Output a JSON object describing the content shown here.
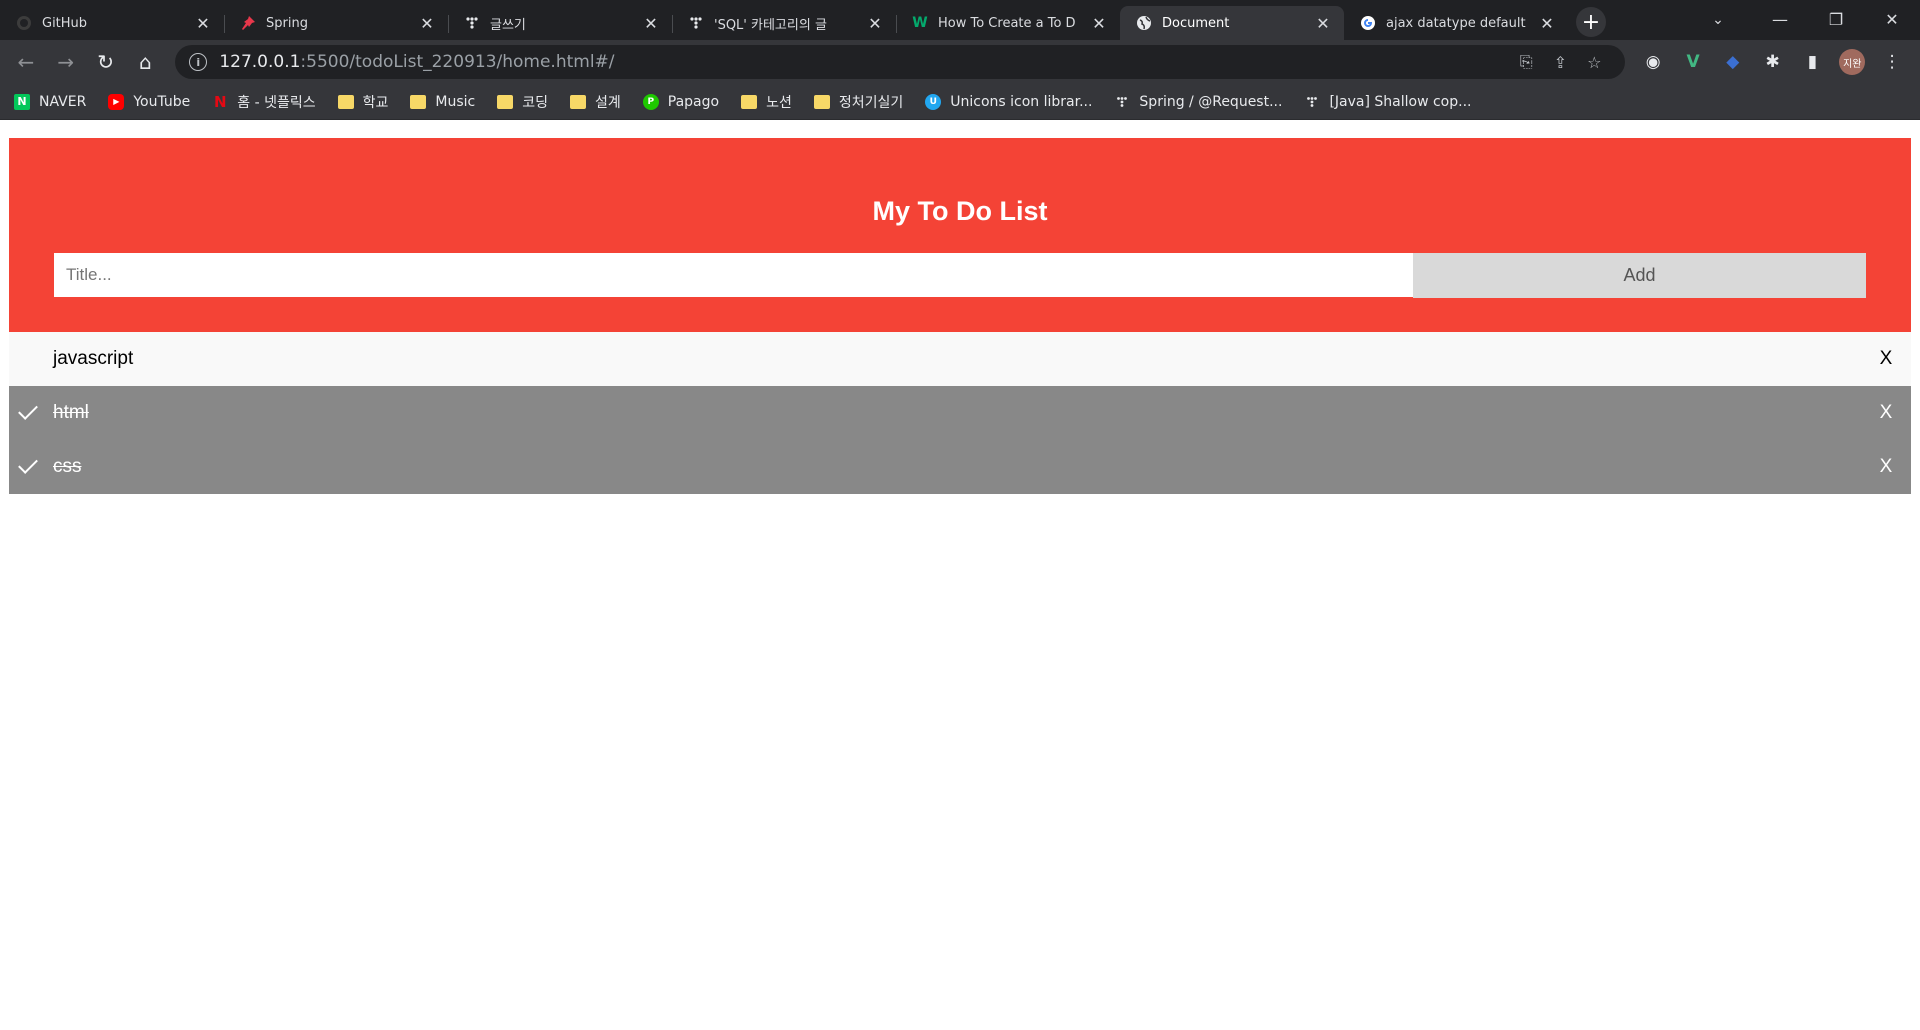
{
  "browser": {
    "tabs": [
      {
        "title": "GitHub",
        "icon": "github-icon"
      },
      {
        "title": "Spring",
        "icon": "pin-icon"
      },
      {
        "title": "글쓰기",
        "icon": "tistory-icon"
      },
      {
        "title": "'SQL' 카테고리의 글",
        "icon": "tistory-icon"
      },
      {
        "title": "How To Create a To D",
        "icon": "w3schools-icon"
      },
      {
        "title": "Document",
        "icon": "globe-icon"
      },
      {
        "title": "ajax datatype default",
        "icon": "google-icon"
      }
    ],
    "active_tab_index": 5,
    "url_host": "127.0.0.1",
    "url_rest": ":5500/todoList_220913/home.html#/",
    "profile_label": "지완",
    "bookmarks": [
      {
        "label": "NAVER",
        "icon": "naver-icon",
        "color": "#03c75a"
      },
      {
        "label": "YouTube",
        "icon": "youtube-icon",
        "color": "#ff0000"
      },
      {
        "label": "홈 - 넷플릭스",
        "icon": "netflix-icon",
        "color": "#e50914"
      },
      {
        "label": "학교",
        "icon": "folder-icon"
      },
      {
        "label": "Music",
        "icon": "folder-icon"
      },
      {
        "label": "코딩",
        "icon": "folder-icon"
      },
      {
        "label": "설계",
        "icon": "folder-icon"
      },
      {
        "label": "Papago",
        "icon": "papago-icon"
      },
      {
        "label": "노션",
        "icon": "folder-icon"
      },
      {
        "label": "정처기실기",
        "icon": "folder-icon"
      },
      {
        "label": "Unicons icon librar...",
        "icon": "unicons-icon"
      },
      {
        "label": "Spring / @Request...",
        "icon": "tistory-icon"
      },
      {
        "label": "[Java] Shallow cop...",
        "icon": "tistory-icon"
      }
    ]
  },
  "page": {
    "header_title": "My To Do List",
    "input_placeholder": "Title...",
    "input_value": "",
    "add_label": "Add",
    "accent_color": "#f44336",
    "todos": [
      {
        "text": "javascript",
        "checked": false,
        "close": "X"
      },
      {
        "text": "html",
        "checked": true,
        "close": "X"
      },
      {
        "text": "css",
        "checked": true,
        "close": "X"
      }
    ]
  }
}
